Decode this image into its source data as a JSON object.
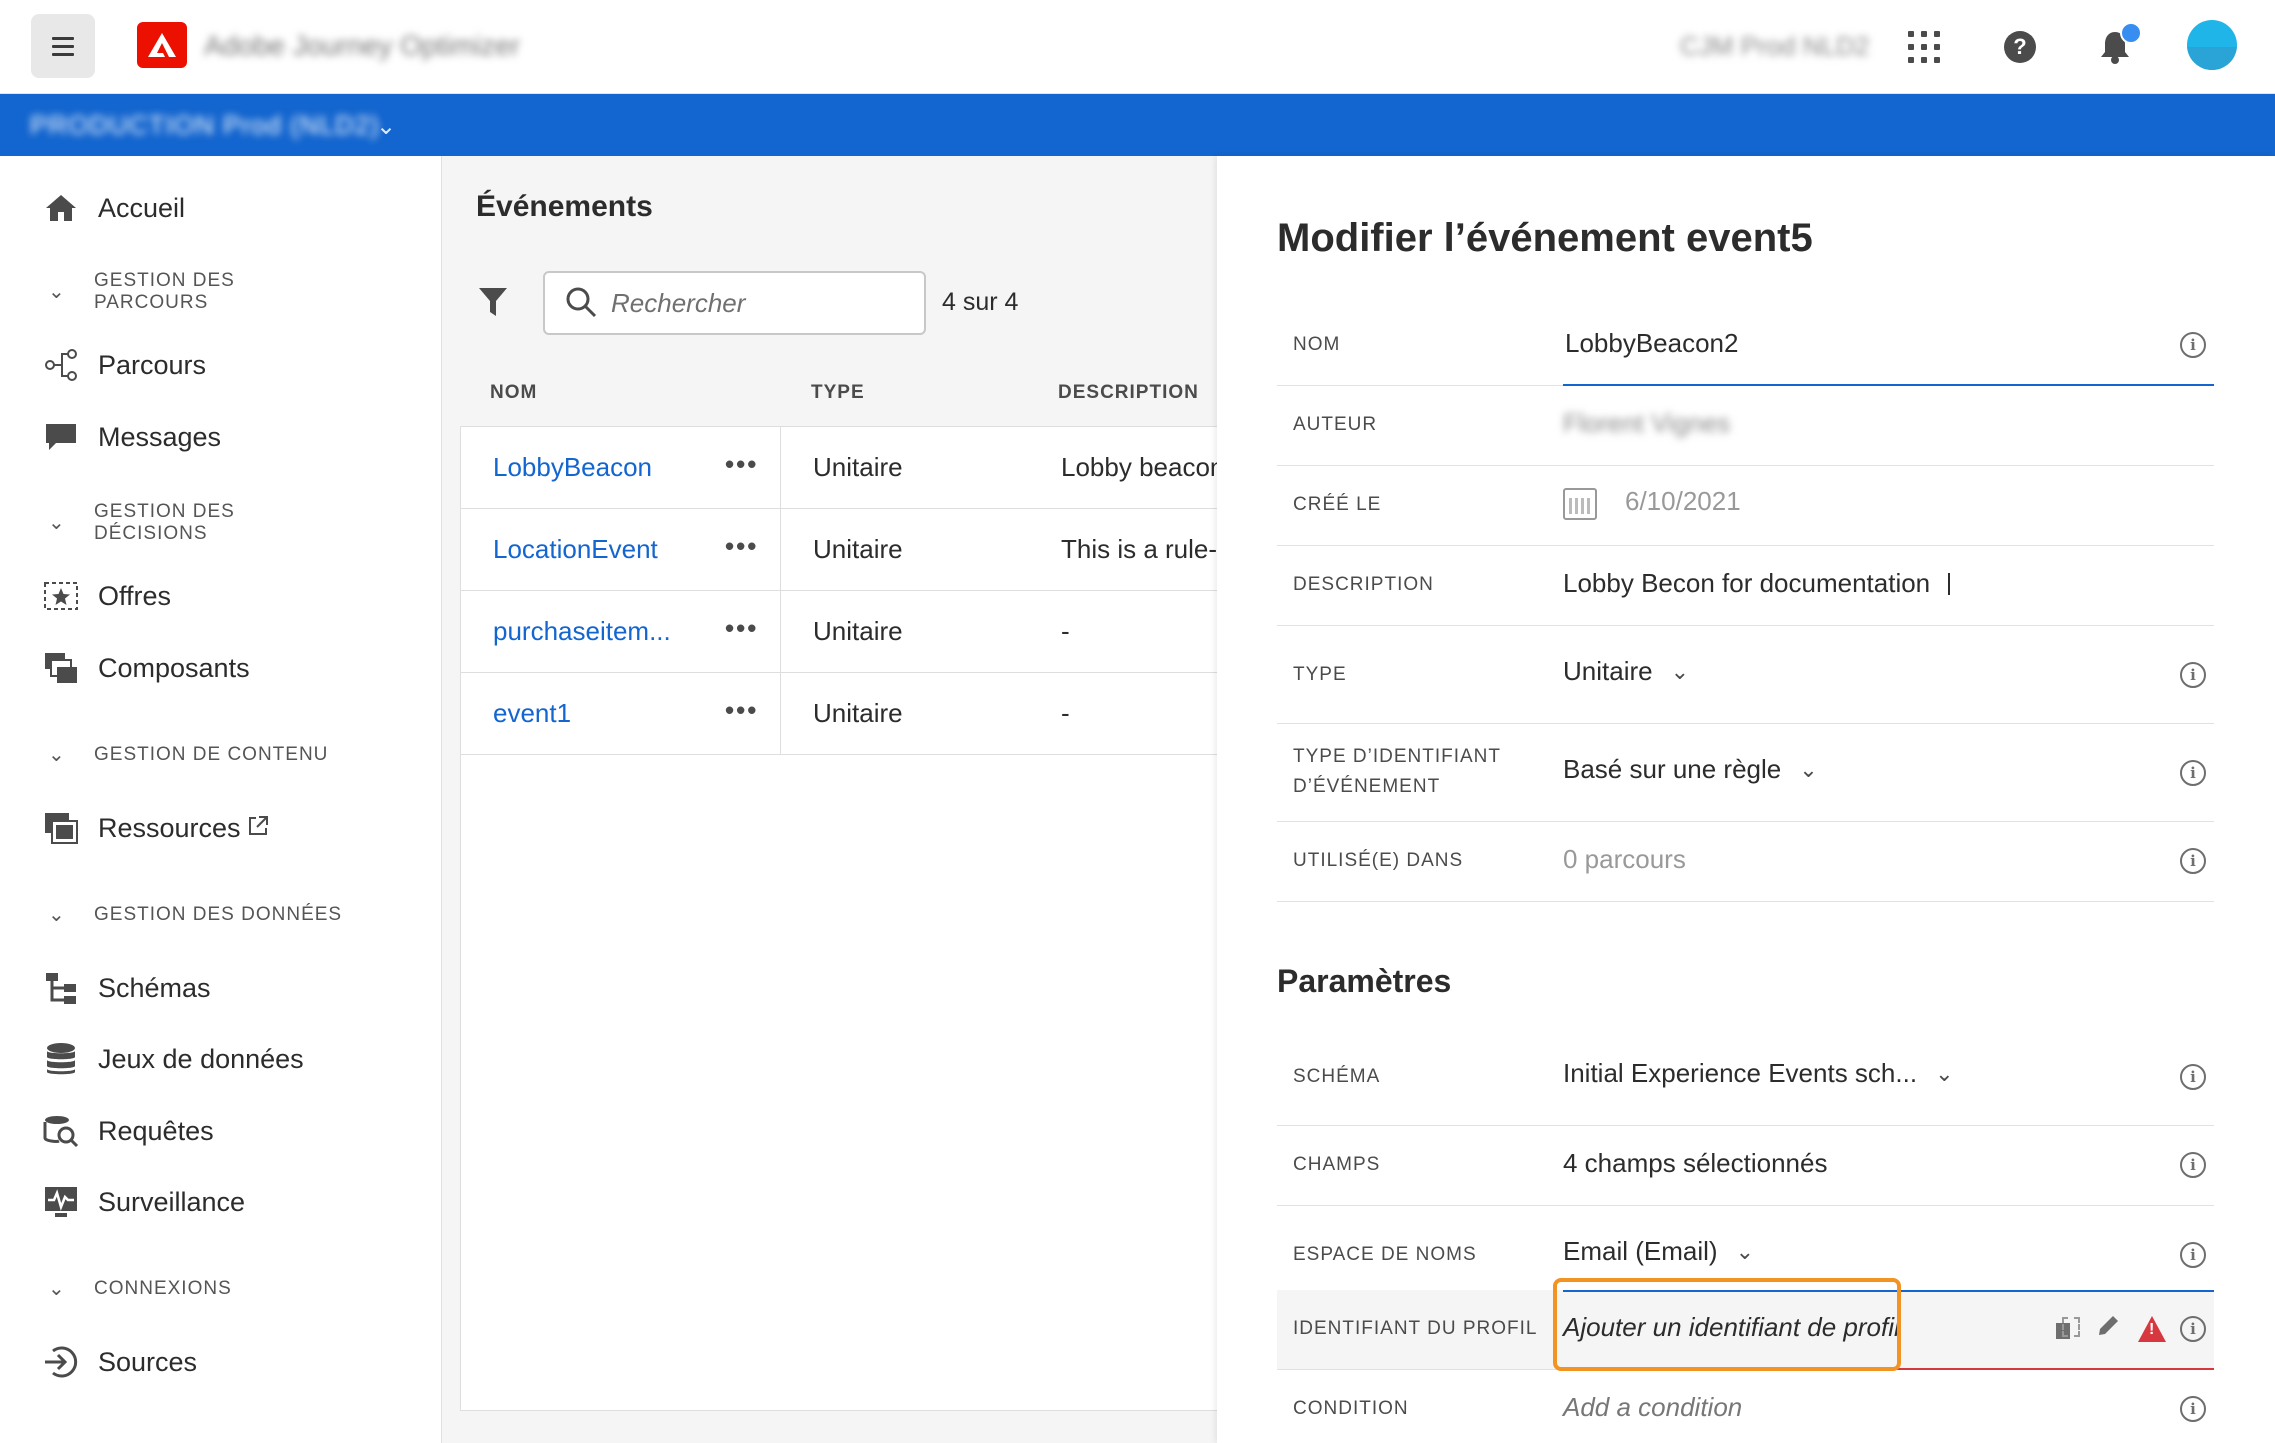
{
  "topbar": {
    "app_title": "Adobe Journey Optimizer",
    "org_name": "CJM Prod NLD2",
    "icons": [
      "menu-icon",
      "adobe-logo",
      "apps-grid-icon",
      "help-icon",
      "bell-icon",
      "avatar"
    ]
  },
  "sandbox": {
    "label": "PRODUCTION  Prod (NLD2)"
  },
  "nav": {
    "home": "Accueil",
    "section_journeys": "GESTION DES PARCOURS",
    "journeys": "Parcours",
    "messages": "Messages",
    "section_decisions": "GESTION DES DÉCISIONS",
    "offers": "Offres",
    "components": "Composants",
    "section_content": "GESTION DE CONTENU",
    "assets": "Ressources",
    "section_data": "GESTION DES DONNÉES",
    "schemas": "Schémas",
    "datasets": "Jeux de données",
    "queries": "Requêtes",
    "monitoring": "Surveillance",
    "section_connections": "CONNEXIONS",
    "sources": "Sources"
  },
  "events": {
    "title": "Événements",
    "search_placeholder": "Rechercher",
    "count": "4 sur 4",
    "columns": {
      "name": "NOM",
      "type": "TYPE",
      "description": "DESCRIPTION"
    },
    "rows": [
      {
        "name": "LobbyBeacon",
        "more": "•••",
        "type": "Unitaire",
        "description": "Lobby beacon"
      },
      {
        "name": "LocationEvent",
        "more": "•••",
        "type": "Unitaire",
        "description": "This is a rule-b"
      },
      {
        "name": "purchaseitem...",
        "more": "•••",
        "type": "Unitaire",
        "description": "-"
      },
      {
        "name": "event1",
        "more": "•••",
        "type": "Unitaire",
        "description": "-"
      }
    ]
  },
  "edit": {
    "title": "Modifier l’événement event5",
    "name_label": "NOM",
    "name_value": "LobbyBeacon2",
    "author_label": "AUTEUR",
    "author_value": "Florent Vignes",
    "created_label": "CRÉÉ LE",
    "created_value": "6/10/2021",
    "description_label": "DESCRIPTION",
    "description_value": "Lobby Becon for documentation",
    "type_label": "TYPE",
    "type_value": "Unitaire",
    "event_id_type_label_1": "TYPE D’IDENTIFIANT",
    "event_id_type_label_2": "D’ÉVÉNEMENT",
    "event_id_type_value": "Basé sur une règle",
    "used_in_label": "UTILISÉ(E) DANS",
    "used_in_value": "0 parcours",
    "parameters_title": "Paramètres",
    "schema_label": "SCHÉMA",
    "schema_value": "Initial Experience Events sch...",
    "fields_label": "CHAMPS",
    "fields_value": "4 champs sélectionnés",
    "namespace_label": "ESPACE DE NOMS",
    "namespace_value": "Email (Email)",
    "profile_id_label": "IDENTIFIANT DU PROFIL",
    "profile_id_value": "Ajouter un identifiant de profil",
    "condition_label": "CONDITION",
    "condition_value": "Add a condition"
  },
  "colors": {
    "brand_blue": "#1365cf",
    "adobe_red": "#eb1000",
    "highlight_orange": "#f29423",
    "error_red": "#d7373f"
  }
}
